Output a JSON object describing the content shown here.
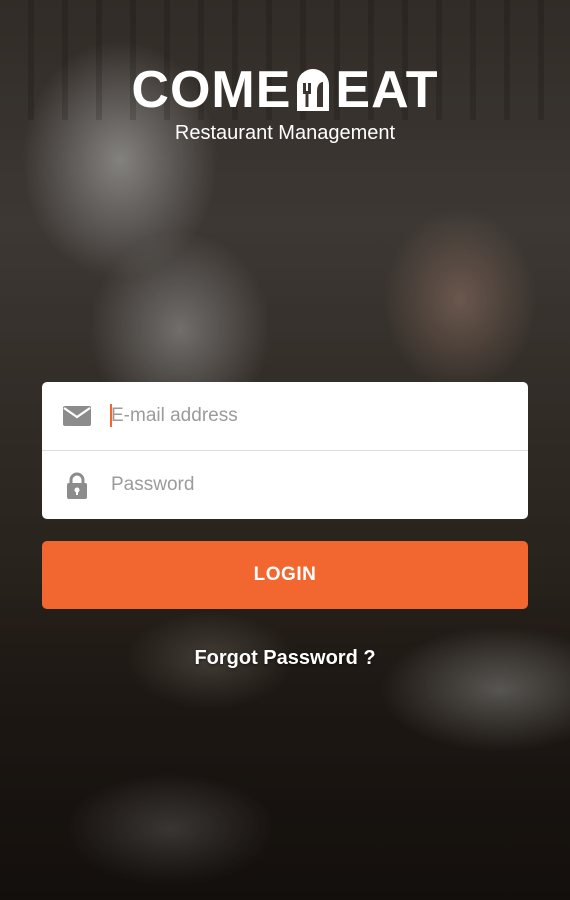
{
  "brand": {
    "logo_left": "COME",
    "logo_right": "EAT",
    "subtitle": "Restaurant Management"
  },
  "login_form": {
    "email": {
      "placeholder": "E-mail address",
      "value": "",
      "icon": "envelope-icon"
    },
    "password": {
      "placeholder": "Password",
      "value": "",
      "icon": "lock-icon"
    },
    "submit_label": "LOGIN",
    "forgot_label": "Forgot Password ?"
  },
  "colors": {
    "accent": "#f26630",
    "card": "#ffffff",
    "icon": "#8c8c8c",
    "placeholder": "#9b9b9b"
  }
}
